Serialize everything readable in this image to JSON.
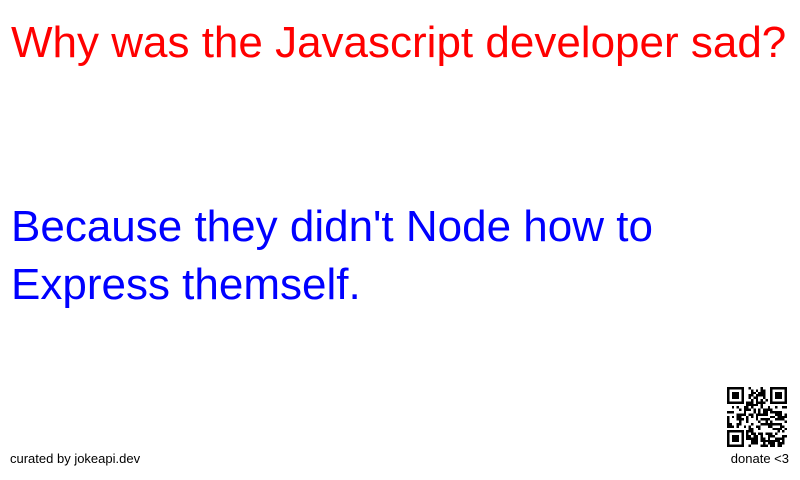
{
  "joke": {
    "setup": "Why was the Javascript developer sad?",
    "delivery": "Because they didn't Node how to Express themself."
  },
  "footer": {
    "credit": "curated by jokeapi.dev",
    "donate": "donate <3"
  },
  "colors": {
    "setup": "#ff0000",
    "delivery": "#0000ff"
  }
}
